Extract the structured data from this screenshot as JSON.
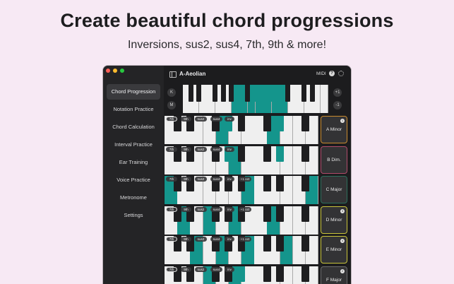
{
  "hero": {
    "title": "Create beautiful chord progressions",
    "subtitle": "Inversions, sus2, sus4, 7th, 9th & more!"
  },
  "window": {
    "scale_title": "A-Aeolian",
    "midi_label": "MIDI",
    "help_glyph": "?"
  },
  "sidebar": {
    "items": [
      {
        "label": "Chord Progression",
        "active": true
      },
      {
        "label": "Notation Practice",
        "active": false
      },
      {
        "label": "Chord Calculation",
        "active": false
      },
      {
        "label": "Interval Practice",
        "active": false
      },
      {
        "label": "Ear Training",
        "active": false
      },
      {
        "label": "Voice Practice",
        "active": false
      },
      {
        "label": "Metronome",
        "active": false
      },
      {
        "label": "Settings",
        "active": false
      }
    ]
  },
  "scale_keyboard": {
    "buttons": [
      "K",
      "M"
    ],
    "octave_up": "+1",
    "octave_down": "-1",
    "highlighted_white": [
      6,
      7,
      8,
      9,
      10,
      11,
      12
    ],
    "highlighted_black": [
      6,
      7,
      8
    ]
  },
  "chord_rows": [
    {
      "chord": "A Minor",
      "badge": "1",
      "border": "#c98a2e",
      "options": [
        "7th",
        "9th",
        "sus2",
        "sus4",
        "inv"
      ],
      "active_options": [
        "7th"
      ],
      "white": [
        4,
        8
      ],
      "black": [
        3,
        6
      ]
    },
    {
      "chord": "B Dim.",
      "badge": "",
      "border": "#b04a6a",
      "options": [
        "7th",
        "9th",
        "sus2",
        "sus4",
        "inv"
      ],
      "active_options": [],
      "white": [
        5
      ],
      "black": [
        3,
        6
      ]
    },
    {
      "chord": "C Major",
      "badge": "",
      "border": "#2c6e5c",
      "options": [
        "7th",
        "9th",
        "sus2",
        "sus4",
        "inv",
        "+1 oct"
      ],
      "active_options": [],
      "white": [
        0,
        6,
        11
      ],
      "black": []
    },
    {
      "chord": "D Minor",
      "badge": "3",
      "border": "#c9c43a",
      "options": [
        "7th",
        "9th",
        "sus2",
        "sus4",
        "inv",
        "+1 oct"
      ],
      "active_options": [
        "7th"
      ],
      "white": [
        1,
        3,
        5,
        8
      ],
      "black": []
    },
    {
      "chord": "E Minor",
      "badge": "4",
      "border": "#c9c43a",
      "options": [
        "7th",
        "9th",
        "sus2",
        "sus4",
        "inv",
        "+1 oct"
      ],
      "active_options": [
        "7th"
      ],
      "white": [
        2,
        4,
        6,
        9
      ],
      "black": []
    },
    {
      "chord": "F Major",
      "badge": "2",
      "border": "#6a6a6c",
      "options": [
        "7th",
        "9th",
        "sus2",
        "sus4",
        "inv"
      ],
      "active_options": [
        "7th"
      ],
      "white": [
        3,
        5
      ],
      "black": [
        4
      ]
    }
  ],
  "colors": {
    "accent": "#14958c",
    "background": "#f7e9f4"
  }
}
